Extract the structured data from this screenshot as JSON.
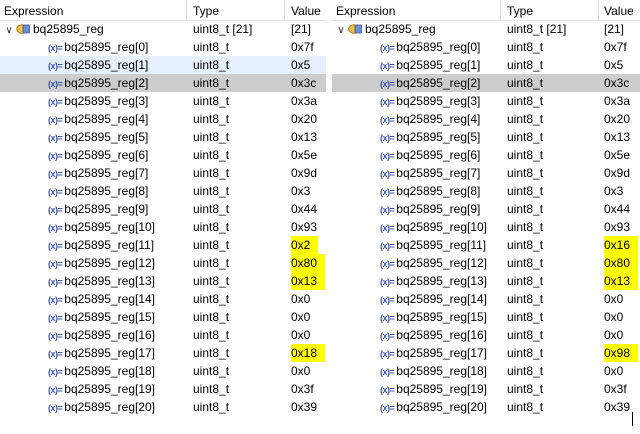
{
  "columns": {
    "expression": "Expression",
    "type": "Type",
    "value": "Value"
  },
  "array": {
    "name": "bq25895_reg",
    "type": "uint8_t [21]",
    "value": "[21]"
  },
  "element_type": "uint8_t",
  "expression_prefix": "(x)=",
  "expand_icon": "chevron-down-icon",
  "array_icon": "array-variable-icon",
  "highlight_color": "#ffff00",
  "selection_color": "#cdcdcd",
  "left_panel": {
    "elements": [
      {
        "name": "bq25895_reg[0]",
        "value": "0x7f"
      },
      {
        "name": "bq25895_reg[1]",
        "value": "0x5"
      },
      {
        "name": "bq25895_reg[2]",
        "value": "0x3c"
      },
      {
        "name": "bq25895_reg[3]",
        "value": "0x3a"
      },
      {
        "name": "bq25895_reg[4]",
        "value": "0x20"
      },
      {
        "name": "bq25895_reg[5]",
        "value": "0x13"
      },
      {
        "name": "bq25895_reg[6]",
        "value": "0x5e"
      },
      {
        "name": "bq25895_reg[7]",
        "value": "0x9d"
      },
      {
        "name": "bq25895_reg[8]",
        "value": "0x3"
      },
      {
        "name": "bq25895_reg[9]",
        "value": "0x44"
      },
      {
        "name": "bq25895_reg[10]",
        "value": "0x93"
      },
      {
        "name": "bq25895_reg[11]",
        "value": "0x2",
        "highlighted": true
      },
      {
        "name": "bq25895_reg[12]",
        "value": "0x80",
        "highlighted": true
      },
      {
        "name": "bq25895_reg[13]",
        "value": "0x13",
        "highlighted": true
      },
      {
        "name": "bq25895_reg[14]",
        "value": "0x0"
      },
      {
        "name": "bq25895_reg[15]",
        "value": "0x0"
      },
      {
        "name": "bq25895_reg[16]",
        "value": "0x0"
      },
      {
        "name": "bq25895_reg[17]",
        "value": "0x18",
        "highlighted": true
      },
      {
        "name": "bq25895_reg[18]",
        "value": "0x0"
      },
      {
        "name": "bq25895_reg[19]",
        "value": "0x3f"
      },
      {
        "name": "bq25895_reg[20]",
        "value": "0x39"
      }
    ],
    "hovered_row": 1,
    "selected_row": 2
  },
  "right_panel": {
    "elements": [
      {
        "name": "bq25895_reg[0]",
        "value": "0x7f"
      },
      {
        "name": "bq25895_reg[1]",
        "value": "0x5"
      },
      {
        "name": "bq25895_reg[2]",
        "value": "0x3c"
      },
      {
        "name": "bq25895_reg[3]",
        "value": "0x3a"
      },
      {
        "name": "bq25895_reg[4]",
        "value": "0x20"
      },
      {
        "name": "bq25895_reg[5]",
        "value": "0x13"
      },
      {
        "name": "bq25895_reg[6]",
        "value": "0x5e"
      },
      {
        "name": "bq25895_reg[7]",
        "value": "0x9d"
      },
      {
        "name": "bq25895_reg[8]",
        "value": "0x3"
      },
      {
        "name": "bq25895_reg[9]",
        "value": "0x44"
      },
      {
        "name": "bq25895_reg[10]",
        "value": "0x93"
      },
      {
        "name": "bq25895_reg[11]",
        "value": "0x16",
        "highlighted": true
      },
      {
        "name": "bq25895_reg[12]",
        "value": "0x80",
        "highlighted": true
      },
      {
        "name": "bq25895_reg[13]",
        "value": "0x13",
        "highlighted": true
      },
      {
        "name": "bq25895_reg[14]",
        "value": "0x0"
      },
      {
        "name": "bq25895_reg[15]",
        "value": "0x0"
      },
      {
        "name": "bq25895_reg[16]",
        "value": "0x0"
      },
      {
        "name": "bq25895_reg[17]",
        "value": "0x98",
        "highlighted": true
      },
      {
        "name": "bq25895_reg[18]",
        "value": "0x0"
      },
      {
        "name": "bq25895_reg[19]",
        "value": "0x3f"
      },
      {
        "name": "bq25895_reg[20]",
        "value": "0x39"
      }
    ],
    "selected_row": 2
  }
}
